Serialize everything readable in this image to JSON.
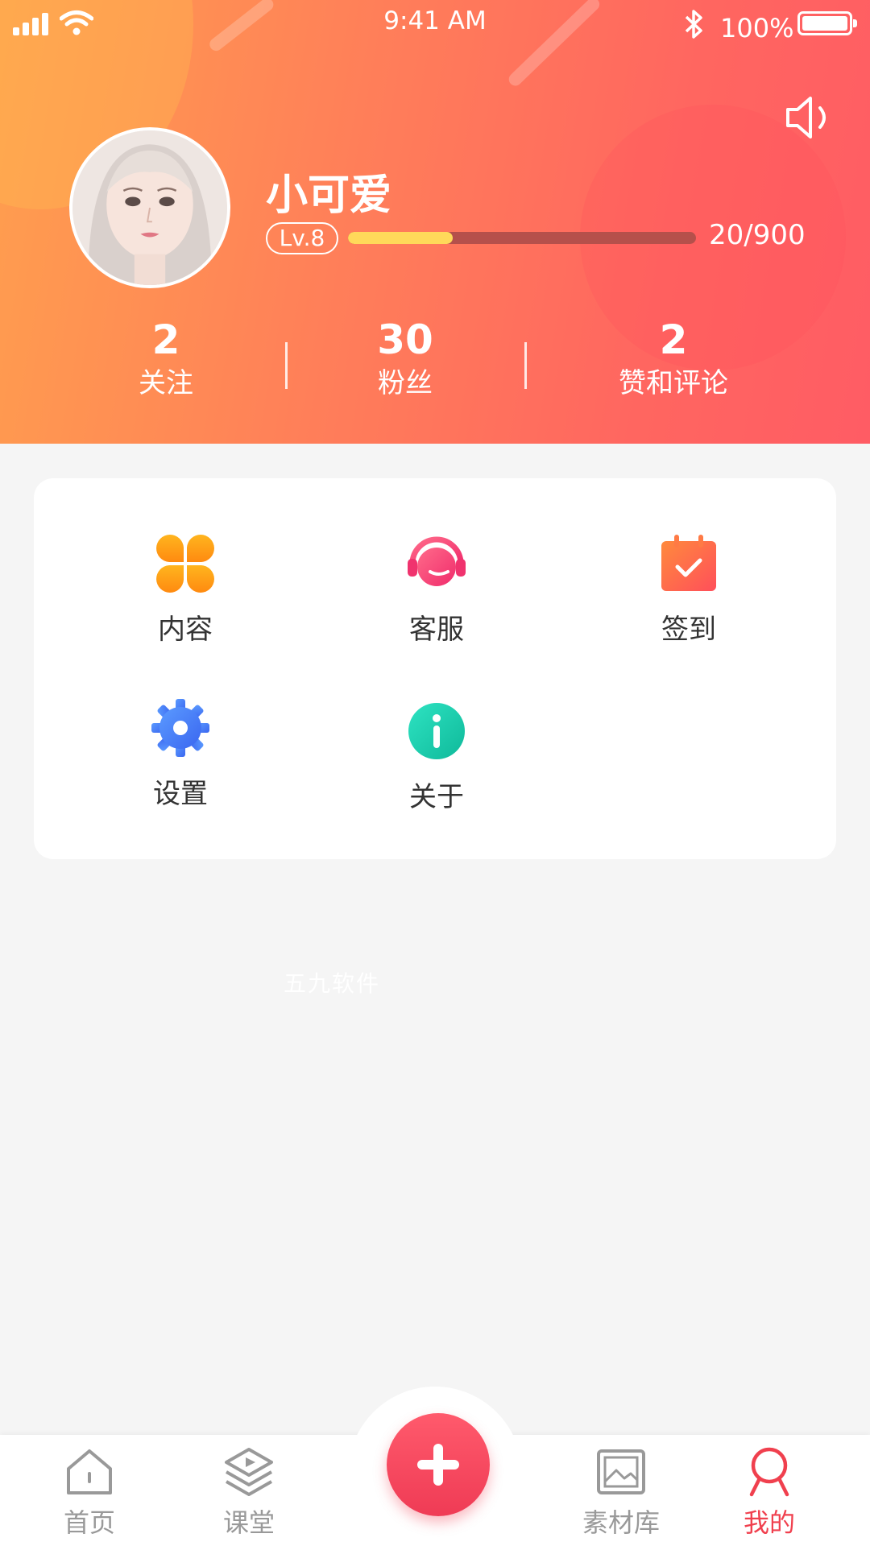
{
  "status_bar": {
    "time": "9:41 AM",
    "battery_percent": "100%"
  },
  "profile": {
    "username": "小可爱",
    "level": "Lv.8",
    "progress_text": "20/900",
    "progress_fraction": 0.3,
    "stats": [
      {
        "value": "2",
        "label": "关注"
      },
      {
        "value": "30",
        "label": "粉丝"
      },
      {
        "value": "2",
        "label": "赞和评论"
      }
    ]
  },
  "menu": {
    "items": [
      {
        "label": "内容",
        "icon": "clover-icon"
      },
      {
        "label": "客服",
        "icon": "headset-icon"
      },
      {
        "label": "签到",
        "icon": "calendar-check-icon"
      },
      {
        "label": "设置",
        "icon": "gear-icon"
      },
      {
        "label": "关于",
        "icon": "info-icon"
      }
    ]
  },
  "watermark": "五九软件",
  "tabbar": {
    "items": [
      {
        "label": "首页",
        "icon": "home-icon",
        "active": false
      },
      {
        "label": "课堂",
        "icon": "play-layers-icon",
        "active": false
      },
      {
        "label": "素材库",
        "icon": "image-icon",
        "active": false
      },
      {
        "label": "我的",
        "icon": "person-icon",
        "active": true
      }
    ],
    "center_button_icon": "plus-icon"
  },
  "colors": {
    "header_gradient_start": "#ff9f4e",
    "header_gradient_end": "#ff5c64",
    "progress_fill": "#ffd95a",
    "active_tab": "#f0404e",
    "add_button": "#ef3b55"
  }
}
